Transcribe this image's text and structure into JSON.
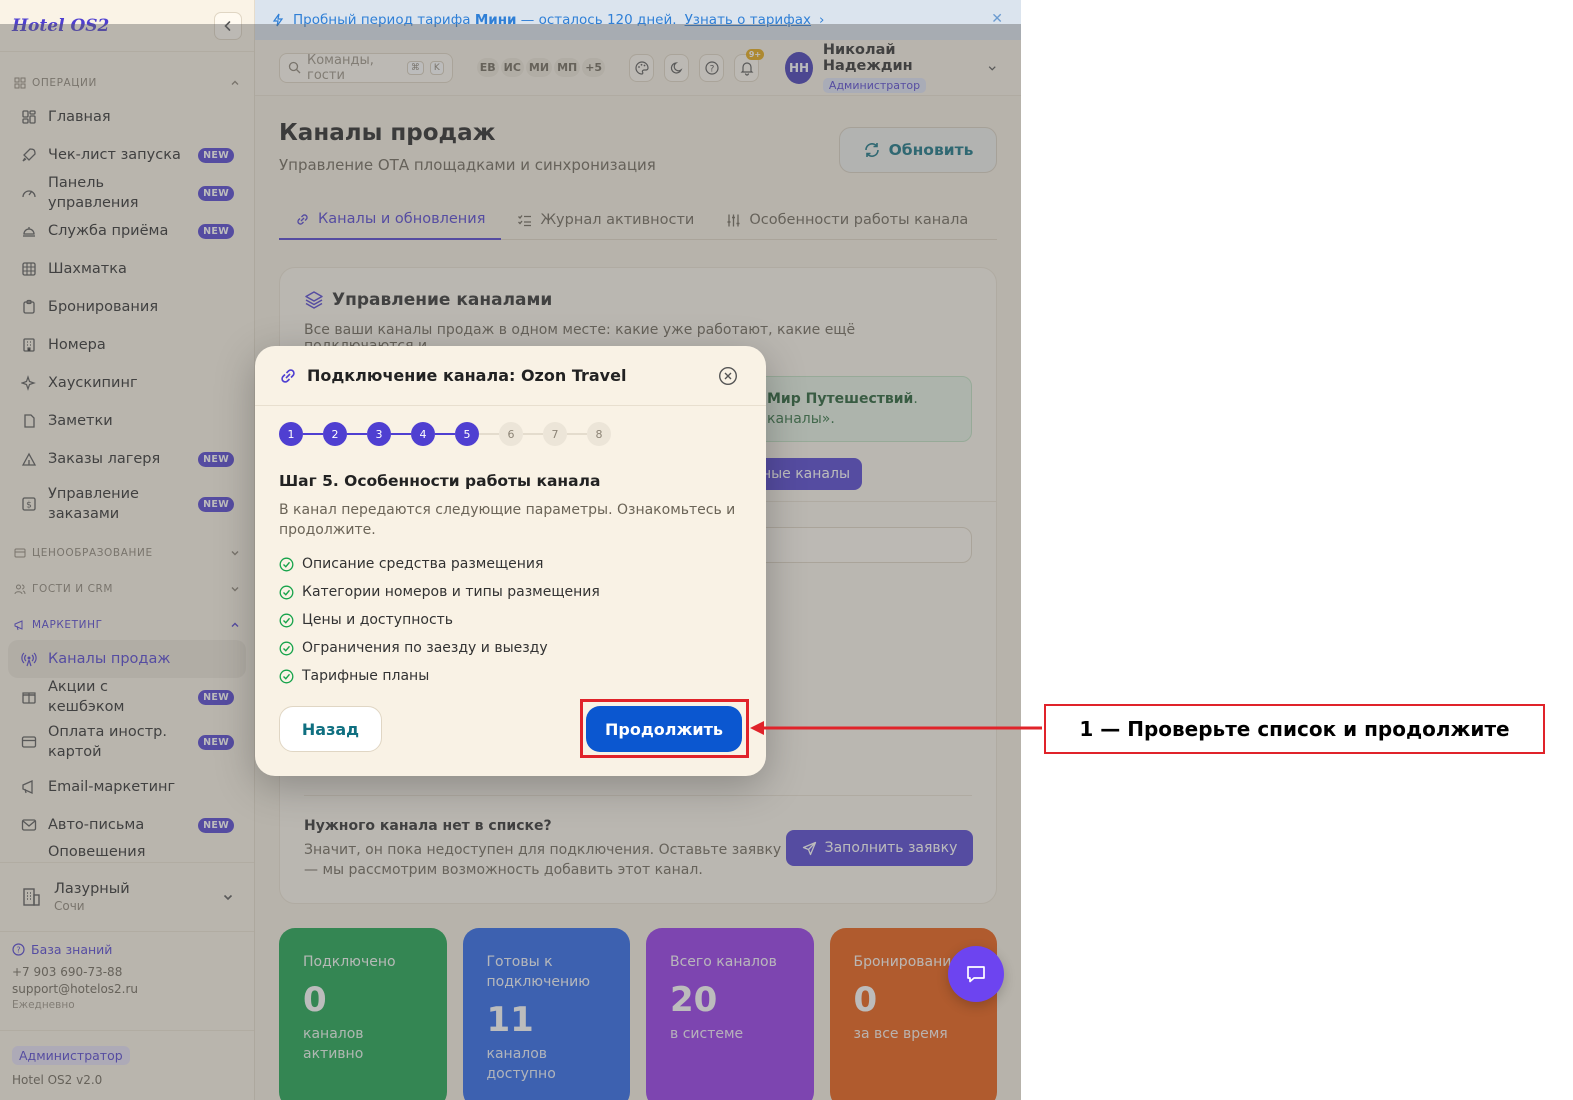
{
  "app": {
    "logo": "Hotel OS2"
  },
  "sidebar": {
    "sections": [
      {
        "label": "ОПЕРАЦИИ"
      },
      {
        "label": "ЦЕНООБРАЗОВАНИЕ"
      },
      {
        "label": "ГОСТИ И CRM"
      },
      {
        "label": "МАРКЕТИНГ"
      }
    ],
    "items": [
      {
        "label": "Главная"
      },
      {
        "label": "Чек-лист запуска",
        "badge": "NEW"
      },
      {
        "label": "Панель управления",
        "badge": "NEW"
      },
      {
        "label": "Служба приёма",
        "badge": "NEW"
      },
      {
        "label": "Шахматка"
      },
      {
        "label": "Бронирования"
      },
      {
        "label": "Номера"
      },
      {
        "label": "Хаускипинг"
      },
      {
        "label": "Заметки"
      },
      {
        "label": "Заказы лагеря",
        "badge": "NEW"
      },
      {
        "label": "Управление заказами",
        "badge": "NEW"
      },
      {
        "label": "Каналы продаж"
      },
      {
        "label": "Акции с кешбэком",
        "badge": "NEW"
      },
      {
        "label": "Оплата иностр. картой",
        "badge": "NEW"
      },
      {
        "label": "Email-маркетинг"
      },
      {
        "label": "Авто-письма",
        "badge": "NEW"
      },
      {
        "label": "Оповещения"
      }
    ],
    "property": {
      "name": "Лазурный",
      "city": "Сочи"
    },
    "support": {
      "kb_label": "База знаний",
      "phone": "+7 903 690-73-88",
      "email": "support@hotelos2.ru",
      "hours": "Ежедневно"
    },
    "footer": {
      "role": "Администратор",
      "version": "Hotel OS2 v2.0"
    }
  },
  "banner": {
    "prefix": "Пробный период тарифа",
    "plan": "Мини",
    "suffix": "— осталось 120 дней.",
    "link": "Узнать о тарифах"
  },
  "topbar": {
    "search_placeholder": "Команды, гости",
    "kbd1": "⌘",
    "kbd2": "K",
    "avatars": [
      "ЕВ",
      "ИС",
      "МИ",
      "МП",
      "+5"
    ],
    "notif_count": "9+",
    "user": {
      "initials": "НН",
      "name": "Николай Надеждин",
      "role": "Администратор"
    }
  },
  "page": {
    "title": "Каналы продаж",
    "subtitle": "Управление ОТА площадками и синхронизация",
    "refresh_label": "Обновить",
    "tabs": [
      {
        "label": "Каналы и обновления"
      },
      {
        "label": "Журнал активности"
      },
      {
        "label": "Особенности работы канала"
      }
    ]
  },
  "card": {
    "title": "Управление каналами",
    "desc": "Все ваши каналы продаж в одном месте: какие уже работают, какие ещё подключаются и",
    "info_bold": "Мир Путешествий",
    "info_tail": ".",
    "info_line2": "каналы».",
    "partial_btn": "ные каналы",
    "missing_title": "Нужного канала нет в списке?",
    "missing_desc": "Значит, он пока недоступен для подключения. Оставьте заявку — мы рассмотрим возможность добавить этот канал.",
    "apply_label": "Заполнить заявку"
  },
  "stats": [
    {
      "label": "Подключено",
      "value": "0",
      "sub": "каналов активно"
    },
    {
      "label": "Готовы к подключению",
      "value": "11",
      "sub": "каналов доступно"
    },
    {
      "label": "Всего каналов",
      "value": "20",
      "sub": "в системе"
    },
    {
      "label": "Бронировани",
      "value": "0",
      "sub": "за все время"
    }
  ],
  "modal": {
    "title": "Подключение канала: Ozon Travel",
    "steps": [
      "1",
      "2",
      "3",
      "4",
      "5",
      "6",
      "7",
      "8"
    ],
    "current_step": 5,
    "step_title": "Шаг 5. Особенности работы канала",
    "step_desc": "В канал передаются следующие параметры. Ознакомьтесь и продолжите.",
    "params": [
      "Описание средства размещения",
      "Категории номеров и типы размещения",
      "Цены и доступность",
      "Ограничения по заезду и выезду",
      "Тарифные планы"
    ],
    "back_label": "Назад",
    "continue_label": "Продолжить"
  },
  "annotation": {
    "callout": "1 — Проверьте список и продолжите"
  },
  "colors": {
    "accent": "#4f3fd1",
    "primary_button": "#0b57d0",
    "annotation": "#e0232a"
  }
}
